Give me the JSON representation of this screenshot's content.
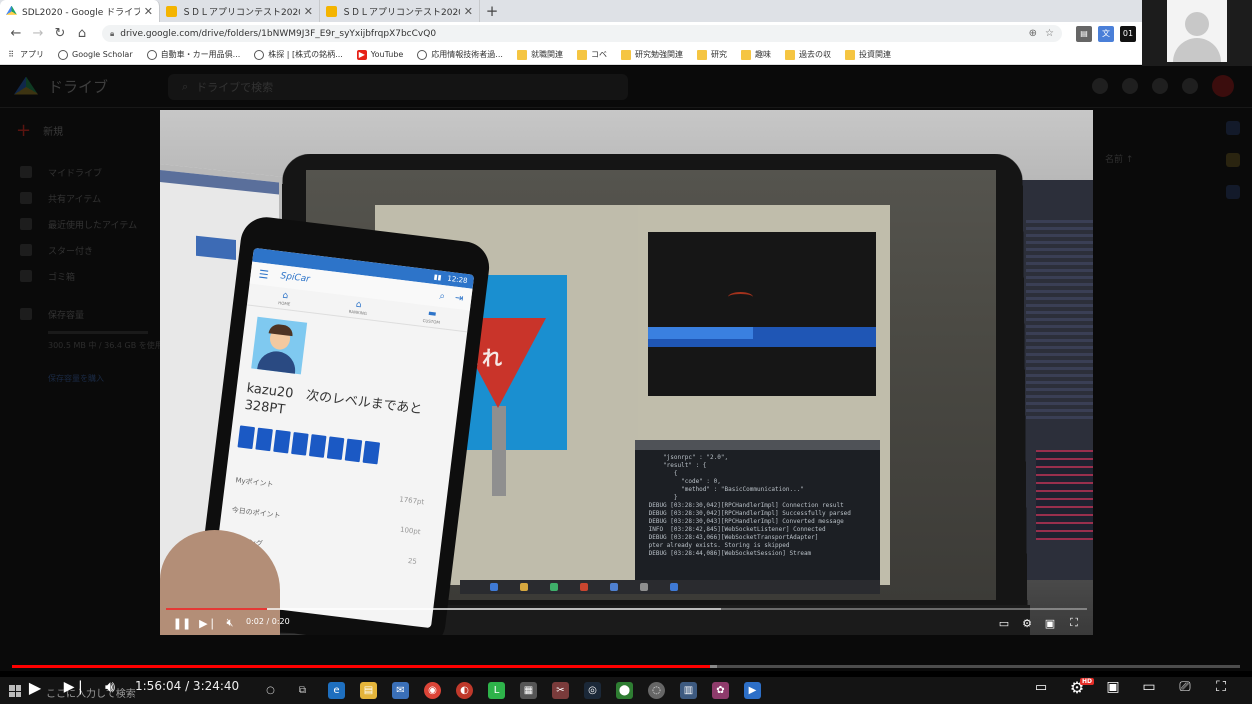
{
  "browser": {
    "tabs": [
      {
        "label": "SDL2020 - Google ドライブ",
        "favicon": "drive",
        "active": true
      },
      {
        "label": "ＳＤＬアプリコンテスト2020 - Goog",
        "favicon": "slides",
        "active": false
      },
      {
        "label": "ＳＤＬアプリコンテスト2020 - Goog",
        "favicon": "slides",
        "active": false
      }
    ],
    "url": "drive.google.com/drive/folders/1bNWM9J3F_E9r_syYxijbfrqpX7bcCvQ0",
    "bookmarks": [
      {
        "label": "アプリ",
        "icon": "apps-grid-icon"
      },
      {
        "label": "Google Scholar",
        "icon": "globe-icon"
      },
      {
        "label": "自動車・カー用品俱...",
        "icon": "globe-icon"
      },
      {
        "label": "株探 | [株式の銘柄...",
        "icon": "globe-icon"
      },
      {
        "label": "YouTube",
        "icon": "youtube-icon"
      },
      {
        "label": "応用情報技術者過...",
        "icon": "globe-icon"
      },
      {
        "label": "就職関連",
        "icon": "folder-icon"
      },
      {
        "label": "コベ",
        "icon": "folder-icon"
      },
      {
        "label": "研究勉強関連",
        "icon": "folder-icon"
      },
      {
        "label": "研究",
        "icon": "folder-icon"
      },
      {
        "label": "趣味",
        "icon": "folder-icon"
      },
      {
        "label": "過去の収",
        "icon": "folder-icon"
      },
      {
        "label": "投資関連",
        "icon": "folder-icon"
      }
    ]
  },
  "drive": {
    "title": "ドライブ",
    "search_placeholder": "ドライブで検索",
    "new_label": "新規",
    "sidebar": [
      {
        "label": "マイドライブ",
        "icon": "my-drive-icon"
      },
      {
        "label": "共有アイテム",
        "icon": "shared-icon"
      },
      {
        "label": "最近使用したアイテム",
        "icon": "recent-icon"
      },
      {
        "label": "スター付き",
        "icon": "star-icon"
      },
      {
        "label": "ゴミ箱",
        "icon": "trash-icon"
      },
      {
        "label": "保存容量",
        "icon": "storage-icon"
      }
    ],
    "storage_text": "300.5 MB 中 / 36.4 GB を使用",
    "storage_link": "保存容量を購入",
    "sort_label": "名前"
  },
  "video_scene": {
    "stop_sign_text": "まれ",
    "terminal_lines": "     \"jsonrpc\" : \"2.0\",\n     \"result\" : {\n        {\n          \"code\" : 0,\n          \"method\" : \"BasicCommunication...\"\n        }\n DEBUG [03:28:30,042][RPCHandlerImpl] Connection result\n DEBUG [03:28:30,042][RPCHandlerImpl] Successfully parsed\n DEBUG [03:28:30,043][RPCHandlerImpl] Converted message\n INFO  [03:28:42,845][WebSocketListener] Connected\n DEBUG [03:28:43,066][WebSocketTransportAdapter]\n pter already exists. Storing is skipped\n DEBUG [03:28:44,086][WebSocketSession] Stream"
  },
  "phone_app": {
    "status_time": "12:28",
    "app_title": "SpiCar",
    "tabs": [
      {
        "icon": "home-icon",
        "label": "HOME"
      },
      {
        "icon": "ranking-icon",
        "label": "RANKING"
      },
      {
        "icon": "garage-icon",
        "label": "CUSTOM"
      }
    ],
    "level_text": "kazu20　次のレベルまであと328PT",
    "level_blocks_filled": 8,
    "stats": [
      {
        "label": "Myポイント",
        "value": "1767pt"
      },
      {
        "label": "今日のポイント",
        "value": "100pt"
      },
      {
        "label": "ランキング",
        "value": "25"
      }
    ]
  },
  "inner_player": {
    "time": "0:02 / 0:20",
    "progress_fraction": 0.11
  },
  "youtube_player": {
    "time": "1:56:04 / 3:24:40",
    "progress_fraction": 0.568,
    "hd_label": "HD"
  },
  "taskbar": {
    "search_text": "ここに入力して検索"
  },
  "colors": {
    "accent_red": "#ff0000",
    "drive_blue": "#1b59c4",
    "chrome_bg": "#dee1e6"
  }
}
